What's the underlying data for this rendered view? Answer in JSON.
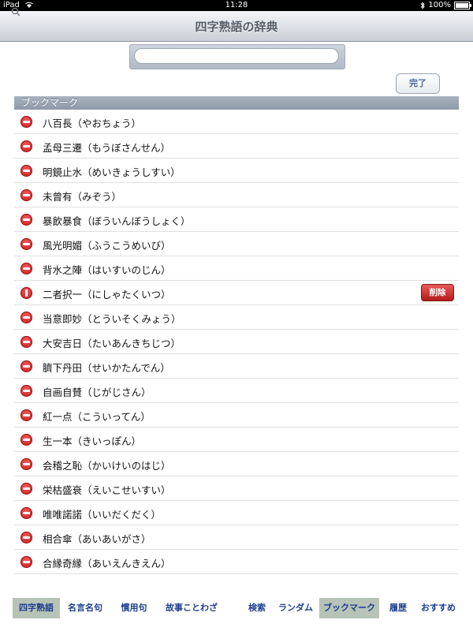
{
  "status": {
    "device": "iPad",
    "time": "11:28",
    "battery": "100%"
  },
  "nav": {
    "title": "四字熟語の辞典"
  },
  "search": {
    "placeholder": ""
  },
  "toolbar": {
    "done_label": "完了"
  },
  "section": {
    "header": "ブックマーク"
  },
  "list": {
    "delete_label": "削除",
    "confirm_index": 7,
    "items": [
      "八百長（やおちょう）",
      "孟母三遷（もうぼさんせん）",
      "明鏡止水（めいきょうしすい）",
      "未曾有（みぞう）",
      "暴飲暴食（ぼういんぼうしょく）",
      "風光明媚（ふうこうめいび）",
      "背水之陣（はいすいのじん）",
      "二者択一（にしゃたくいつ）",
      "当意即妙（とういそくみょう）",
      "大安吉日（たいあんきちじつ）",
      "臍下丹田（せいかたんでん）",
      "自画自賛（じがじさん）",
      "紅一点（こういってん）",
      "生一本（きいっぽん）",
      "会稽之恥（かいけいのはじ）",
      "栄枯盛衰（えいこせいすい）",
      "唯唯諾諾（いいだくだく）",
      "相合傘（あいあいがさ）",
      "合縁奇縁（あいえんきえん）"
    ]
  },
  "tabs": {
    "left": [
      {
        "label": "四字熟語",
        "selected": true
      },
      {
        "label": "名言名句",
        "selected": false
      },
      {
        "label": "慣用句",
        "selected": false
      },
      {
        "label": "故事ことわざ",
        "selected": false
      }
    ],
    "right": [
      {
        "label": "検索",
        "selected": false
      },
      {
        "label": "ランダム",
        "selected": false
      },
      {
        "label": "ブックマーク",
        "selected": true
      },
      {
        "label": "履歴",
        "selected": false
      },
      {
        "label": "おすすめ",
        "selected": false
      }
    ]
  }
}
